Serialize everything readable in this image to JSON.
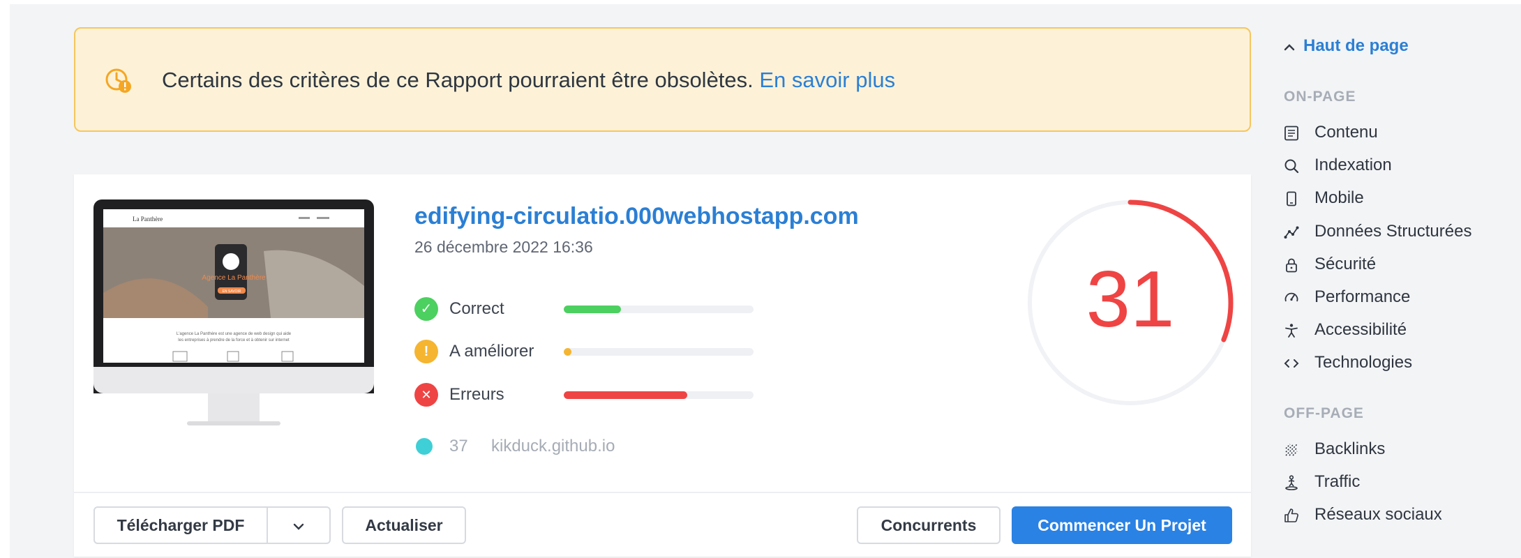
{
  "banner": {
    "text": "Certains des critères de ce Rapport pourraient être obsolètes.",
    "link": "En savoir plus"
  },
  "report": {
    "url": "edifying-circulatio.000webhostapp.com",
    "date": "26 décembre 2022 16:36",
    "score": "31",
    "metrics": [
      {
        "label": "Correct",
        "value": 0.3,
        "color": "#4cd05f",
        "icon": "check-icon"
      },
      {
        "label": "A améliorer",
        "value": 0.04,
        "color": "#f5b530",
        "icon": "exclamation-icon"
      },
      {
        "label": "Erreurs",
        "value": 0.65,
        "color": "#ef4444",
        "icon": "cross-icon"
      }
    ],
    "competitor": {
      "score": "37",
      "domain": "kikduck.github.io"
    },
    "score_fraction": 0.31,
    "score_color": "#ef4444"
  },
  "buttons": {
    "pdf": "Télécharger PDF",
    "refresh": "Actualiser",
    "competitors": "Concurrents",
    "start": "Commencer Un Projet"
  },
  "nav": {
    "top": "Haut de page",
    "on_page_title": "ON-PAGE",
    "on_page": [
      "Contenu",
      "Indexation",
      "Mobile",
      "Données Structurées",
      "Sécurité",
      "Performance",
      "Accessibilité",
      "Technologies"
    ],
    "off_page_title": "OFF-PAGE",
    "off_page": [
      "Backlinks",
      "Traffic",
      "Réseaux sociaux"
    ]
  },
  "thumbnail": {
    "brand": "La Panthère",
    "headline": "Agence La Panthère",
    "cta": "EN SAVOIR",
    "blurb_1": "L'agence La Panthère est une agence de web design qui aide",
    "blurb_2": "les entreprises à prendre de la force et à obtenir sur internet"
  }
}
